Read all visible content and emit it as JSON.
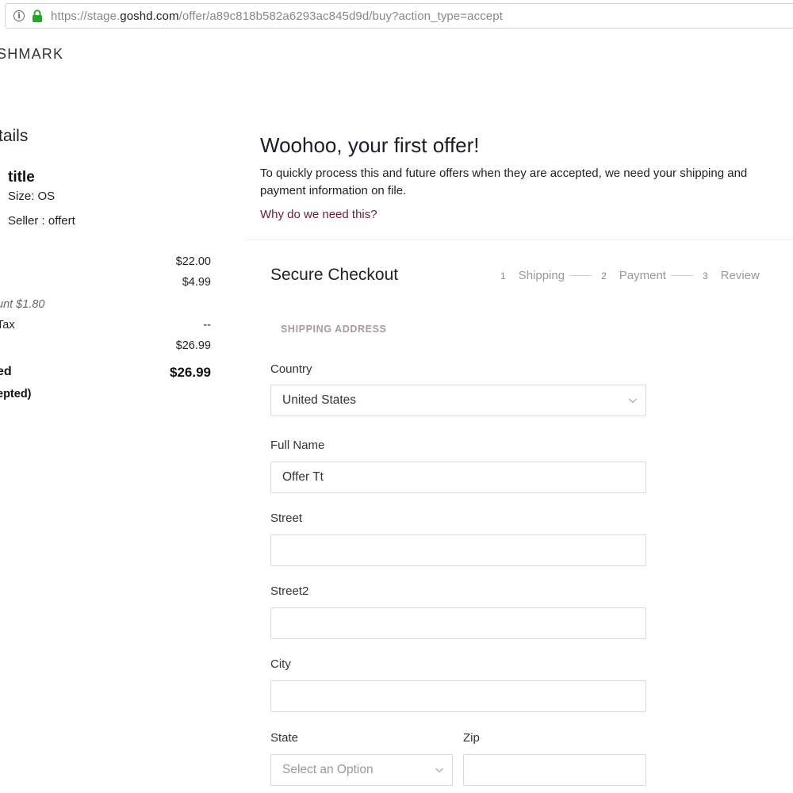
{
  "browser": {
    "url_prefix": "https://stage.",
    "url_host": "goshd.com",
    "url_rest": "/offer/a89c818b582a6293ac845d9d/buy?action_type=accept"
  },
  "brand": {
    "name": "SHMARK"
  },
  "summary": {
    "heading": "tails",
    "item_title": "title",
    "item_size": "Size: OS",
    "item_seller": "Seller : offert",
    "rows": [
      {
        "label": "",
        "value": "$22.00"
      },
      {
        "label": "",
        "value": "$4.99"
      },
      {
        "label": "Tax",
        "value": "--"
      },
      {
        "label": "",
        "value": "$26.99"
      }
    ],
    "discount": "unt $1.80",
    "total_label": "ed",
    "total_value": "$26.99",
    "accepted_note": "epted)"
  },
  "hero": {
    "title": "Woohoo, your first offer!",
    "text": "To quickly process this and future offers when they are accepted, we need your shipping and payment information on file.",
    "link": "Why do we need this?"
  },
  "checkout": {
    "title": "Secure Checkout",
    "steps": [
      {
        "num": "1",
        "label": "Shipping"
      },
      {
        "num": "2",
        "label": "Payment"
      },
      {
        "num": "3",
        "label": "Review"
      }
    ],
    "section_label": "SHIPPING ADDRESS",
    "fields": {
      "country": {
        "label": "Country",
        "value": "United States"
      },
      "full_name": {
        "label": "Full Name",
        "value": "Offer Tt"
      },
      "street": {
        "label": "Street",
        "value": ""
      },
      "street2": {
        "label": "Street2",
        "value": ""
      },
      "city": {
        "label": "City",
        "value": ""
      },
      "state": {
        "label": "State",
        "placeholder": "Select an Option"
      },
      "zip": {
        "label": "Zip",
        "value": ""
      }
    }
  },
  "colors": {
    "accent_link": "#6b1b3a",
    "lock_green": "#2aa52a",
    "border": "#d9d9d9"
  }
}
